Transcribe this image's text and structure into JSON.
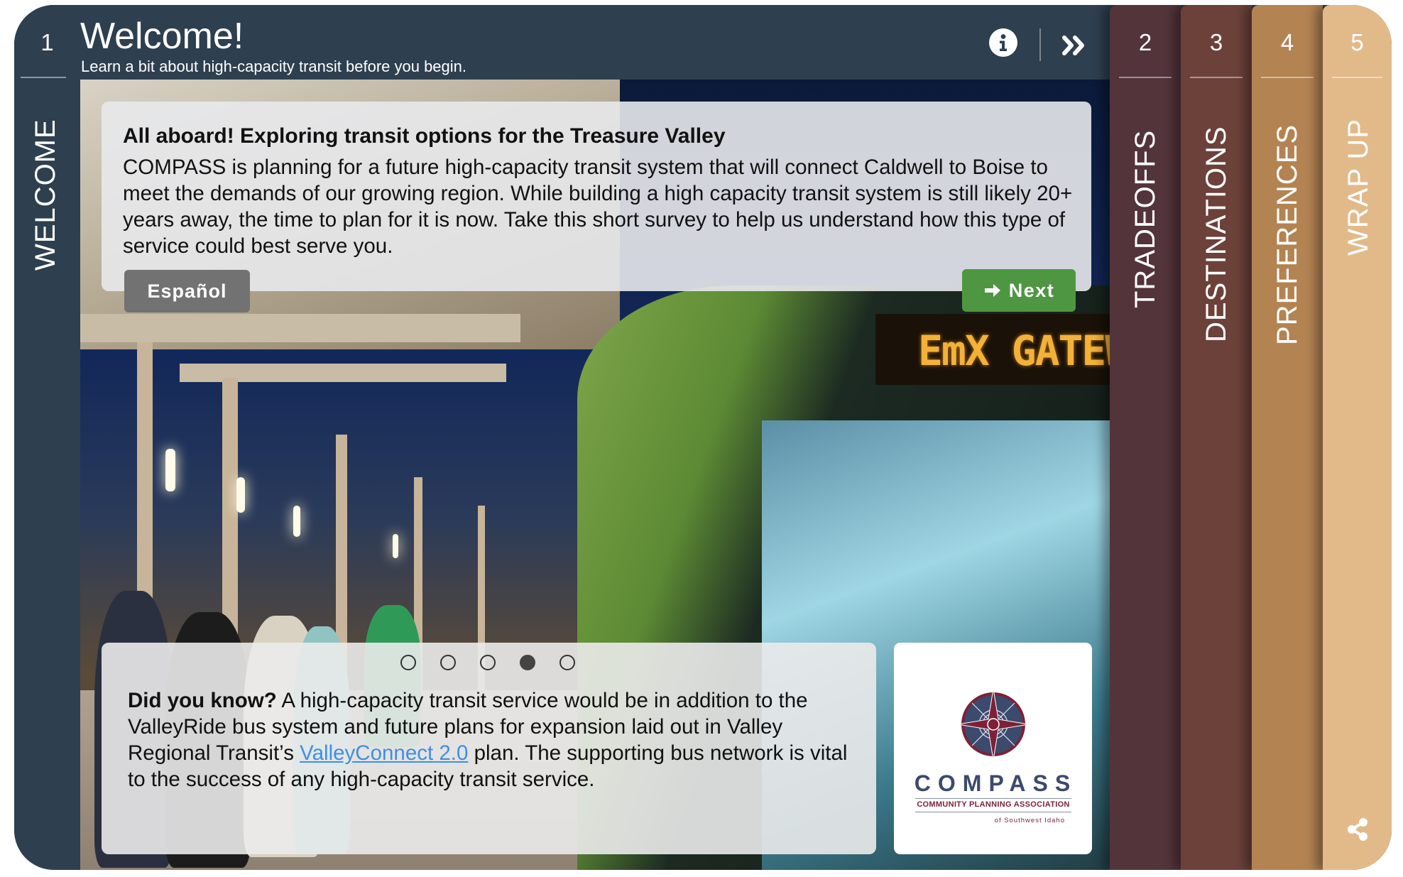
{
  "header": {
    "step_number": "1",
    "title": "Welcome!",
    "subtitle": "Learn a bit about high-capacity transit before you begin.",
    "info_icon": "info-circle-icon",
    "skip_icon": "double-chevron-right-icon"
  },
  "steps": [
    {
      "number": "1",
      "label": "WELCOME",
      "active": true,
      "color": "#2e3f4f"
    },
    {
      "number": "2",
      "label": "TRADEOFFS",
      "active": false,
      "color": "#53343b"
    },
    {
      "number": "3",
      "label": "DESTINATIONS",
      "active": false,
      "color": "#6c413a"
    },
    {
      "number": "4",
      "label": "PREFERENCES",
      "active": false,
      "color": "#b38352"
    },
    {
      "number": "5",
      "label": "WRAP UP",
      "active": false,
      "color": "#e2ba8a"
    }
  ],
  "intro_card": {
    "heading": "All aboard! Exploring transit options for the Treasure Valley",
    "body": "COMPASS is planning for a future high-capacity transit system that will connect Caldwell to Boise to meet the demands of our growing region. While building a high capacity transit system is still likely 20+ years away, the time to plan for it is now. Take this short survey to help us understand how this type of service could best serve you."
  },
  "buttons": {
    "espanol": "Español",
    "next": "Next",
    "next_icon": "arrow-right-icon",
    "next_color": "#4f9642"
  },
  "photo": {
    "bus_sign_text": "EmX GATEW"
  },
  "fact_card": {
    "carousel": {
      "total": 5,
      "active_index": 3
    },
    "lead": "Did you know?",
    "text_before_link": " A high-capacity transit service would be in addition to the ValleyRide bus system and future plans for expansion laid out in Valley Regional Transit’s ",
    "link_text": "ValleyConnect 2.0",
    "text_after_link": " plan. The supporting bus network is vital to the success of any high-capacity transit service."
  },
  "logo": {
    "name": "COMPASS",
    "tagline": "COMMUNITY PLANNING ASSOCIATION",
    "region": "of Southwest Idaho",
    "colors": {
      "navy": "#3c4a6e",
      "maroon": "#7c2238"
    }
  },
  "share_icon": "share-icon"
}
